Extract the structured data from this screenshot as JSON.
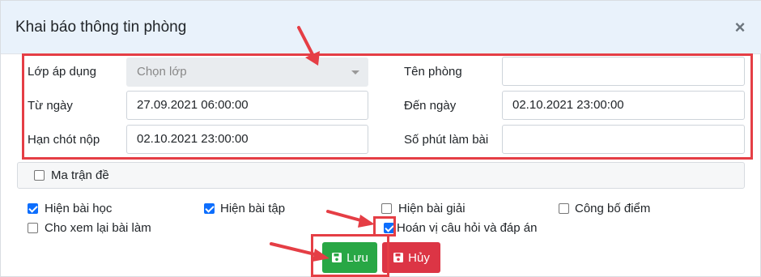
{
  "dialog": {
    "title": "Khai báo thông tin phòng",
    "close_symbol": "×"
  },
  "form": {
    "class_label": "Lớp áp dụng",
    "class_placeholder": "Chọn lớp",
    "room_name_label": "Tên phòng",
    "room_name_value": "",
    "from_date_label": "Từ ngày",
    "from_date_value": "27.09.2021 06:00:00",
    "to_date_label": "Đến ngày",
    "to_date_value": "02.10.2021 23:00:00",
    "deadline_label": "Hạn chót nộp",
    "deadline_value": "02.10.2021 23:00:00",
    "minutes_label": "Số phút làm bài",
    "minutes_value": ""
  },
  "matrix": {
    "label": "Ma trận đề",
    "checked": false
  },
  "options": [
    {
      "label": "Hiện bài học",
      "checked": true
    },
    {
      "label": "Hiện bài tập",
      "checked": true
    },
    {
      "label": "Hiện bài giải",
      "checked": false
    },
    {
      "label": "Công bố điểm",
      "checked": false
    },
    {
      "label": "Cho xem lại bài làm",
      "checked": false
    },
    {
      "label": "Hoán vị câu hỏi và đáp án",
      "checked": true
    }
  ],
  "buttons": {
    "save_label": "Lưu",
    "cancel_label": "Hủy"
  },
  "colors": {
    "annotation": "#e53e45",
    "save": "#28a745",
    "cancel": "#dc3545",
    "checkbox": "#0d6efd",
    "header_bg": "#e9f2fb"
  },
  "icons": {
    "close": "close-icon",
    "dropdown": "chevron-down-icon",
    "save": "floppy-disk-icon",
    "cancel": "floppy-disk-icon"
  }
}
